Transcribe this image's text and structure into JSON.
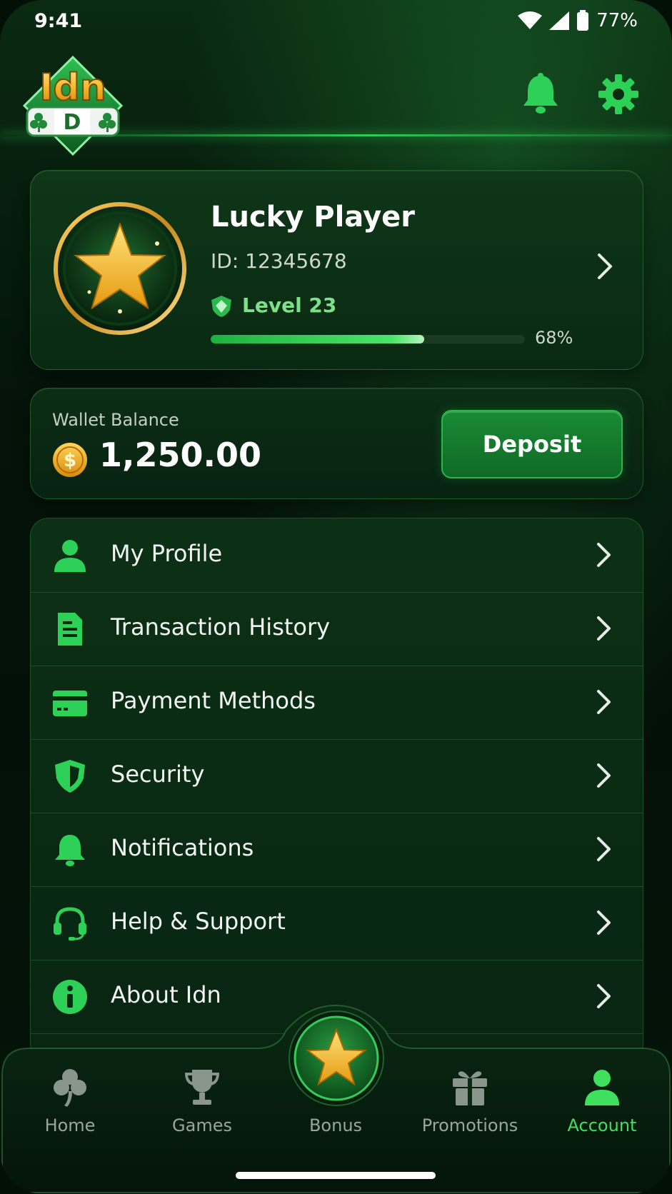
{
  "status_bar": {
    "time": "9:41",
    "battery": "77%"
  },
  "header": {
    "logo_top": "Idn",
    "logo_reel": "D"
  },
  "profile": {
    "name": "Lucky Player",
    "id": "ID: 12345678",
    "level": "Level 23",
    "progress_label": "68%",
    "progress_value": 0.68
  },
  "wallet": {
    "label": "Wallet Balance",
    "amount": "1,250.00",
    "deposit_label": "Deposit"
  },
  "menu": {
    "items": [
      {
        "label": "My Profile",
        "icon": "user-icon"
      },
      {
        "label": "Transaction History",
        "icon": "document-icon"
      },
      {
        "label": "Payment Methods",
        "icon": "card-icon"
      },
      {
        "label": "Security",
        "icon": "shield-icon"
      },
      {
        "label": "Notifications",
        "icon": "bell-icon"
      },
      {
        "label": "Help & Support",
        "icon": "headset-icon"
      },
      {
        "label": "About Idn",
        "icon": "info-icon"
      }
    ]
  },
  "nav": {
    "items": [
      {
        "label": "Home",
        "icon": "clover-icon"
      },
      {
        "label": "Games",
        "icon": "trophy-icon"
      },
      {
        "label": "Bonus",
        "icon": "star-icon"
      },
      {
        "label": "Promotions",
        "icon": "gift-icon"
      },
      {
        "label": "Account",
        "icon": "user-icon"
      }
    ],
    "active": "Account"
  },
  "colors": {
    "accent": "#3ee05e",
    "gold": "#f5c12b",
    "background": "#04150a"
  }
}
